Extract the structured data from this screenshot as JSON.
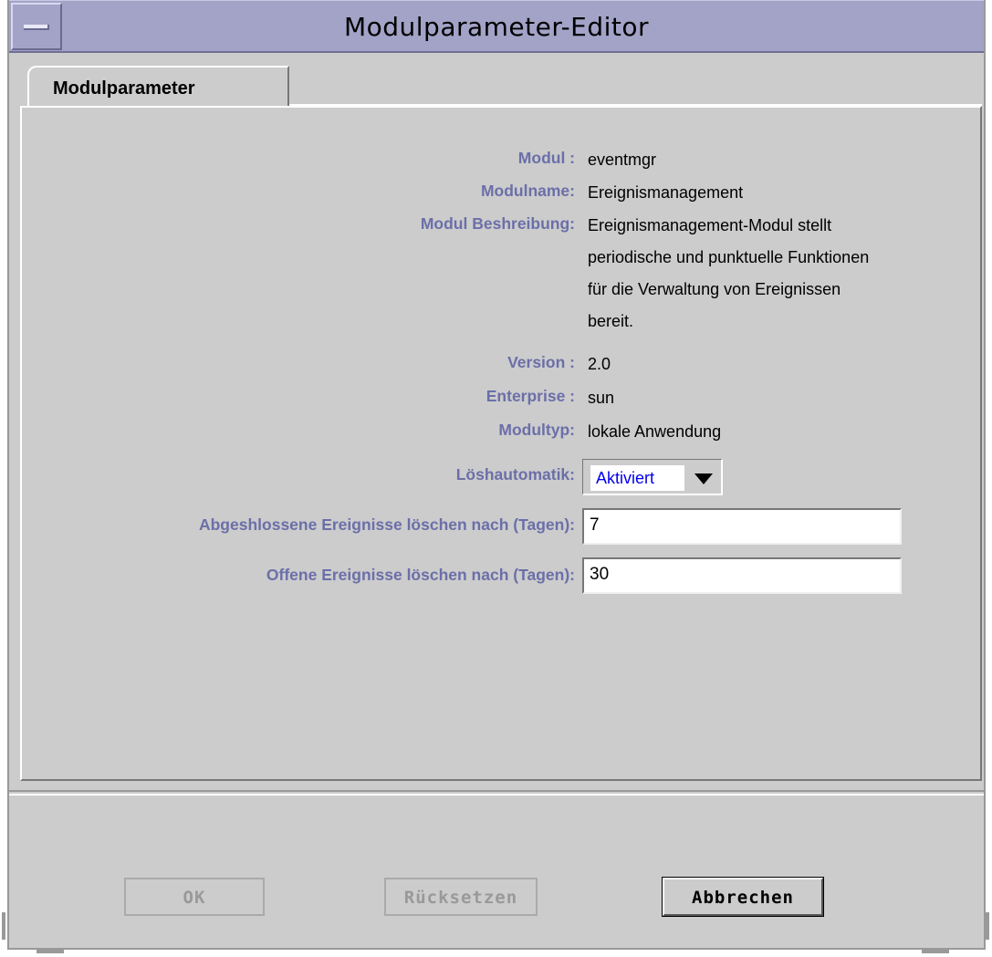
{
  "window": {
    "title": "Modulparameter-Editor"
  },
  "tabs": [
    {
      "label": "Modulparameter",
      "selected": true
    }
  ],
  "info": {
    "modul_label": "Modul :",
    "modul_value": "eventmgr",
    "modulname_label": "Modulname:",
    "modulname_value": "Ereignismanagement",
    "beschreibung_label": "Modul Beshreibung:",
    "beschreibung_lines": [
      "Ereignismanagement-Modul stellt",
      "periodische und punktuelle Funktionen",
      "für die Verwaltung von Ereignissen",
      "bereit."
    ],
    "version_label": "Version :",
    "version_value": "2.0",
    "enterprise_label": "Enterprise :",
    "enterprise_value": "sun",
    "modultyp_label": "Modultyp:",
    "modultyp_value": "lokale Anwendung"
  },
  "params": {
    "loeschautomatik_label": "Löshautomatik:",
    "loeschautomatik_value": "Aktiviert",
    "abgeschlossen_label": "Abgeshlossene Ereignisse löschen nach (Tagen):",
    "abgeschlossen_value": "7",
    "offen_label": "Offene Ereignisse löschen nach (Tagen):",
    "offen_value": "30"
  },
  "buttons": {
    "ok": "OK",
    "reset": "Rücksetzen",
    "cancel": "Abbrechen"
  },
  "colors": {
    "titlebar": "#a3a3c8",
    "label": "#6b6fa8",
    "combo_text": "#0000ee",
    "background": "#cccccc"
  }
}
